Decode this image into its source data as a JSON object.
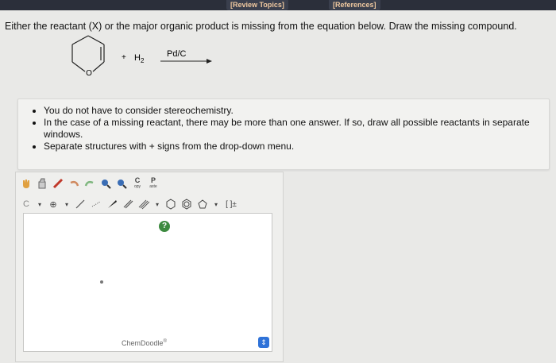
{
  "header": {
    "review_topics": "[Review Topics]",
    "references": "[References]"
  },
  "question": {
    "text": "Either the reactant (X) or the major organic product is missing from the equation below. Draw the missing compound."
  },
  "equation": {
    "ring_heteroatom": "O",
    "plus": "+",
    "reagent": "H",
    "reagent_subscript": "2",
    "catalyst": "Pd/C"
  },
  "notes": {
    "items": [
      "You do not have to consider stereochemistry.",
      "In the case of a missing reactant, there may be more than one answer. If so, draw all possible reactants in separate windows.",
      "Separate structures with + signs from the drop-down menu."
    ]
  },
  "toolbar": {
    "copy_letter": "C",
    "copy_label": "opy",
    "paste_letter": "P",
    "paste_label": "aste",
    "carbon_label": "C",
    "bracket_label": "[ ]±"
  },
  "canvas": {
    "help": "?",
    "brand": "ChemDoodle",
    "brand_mark": "®"
  },
  "colors": {
    "topbar": "#2b2f3a",
    "link": "#f0c9a0",
    "help_green": "#3c8a3f",
    "scroll_blue": "#2f72d8"
  }
}
